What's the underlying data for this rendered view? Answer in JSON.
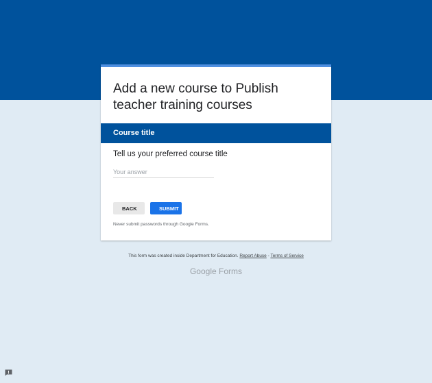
{
  "form": {
    "title": "Add a new course to Publish teacher training courses",
    "section_title": "Course title",
    "question_label": "Tell us your preferred course title",
    "answer_placeholder": "Your answer",
    "answer_value": "",
    "back_label": "BACK",
    "submit_label": "SUBMIT",
    "disclaimer": "Never submit passwords through Google Forms."
  },
  "footer": {
    "created_text": "This form was created inside Department for Education.",
    "report_abuse": "Report Abuse",
    "separator": "-",
    "terms": "Terms of Service"
  },
  "brand": {
    "google": "Google",
    "forms": "Forms"
  },
  "colors": {
    "header_blue": "#00529c",
    "accent_blue": "#1a73e8",
    "background": "#e0ebf4"
  },
  "icons": {
    "feedback": "report-feedback-icon"
  }
}
